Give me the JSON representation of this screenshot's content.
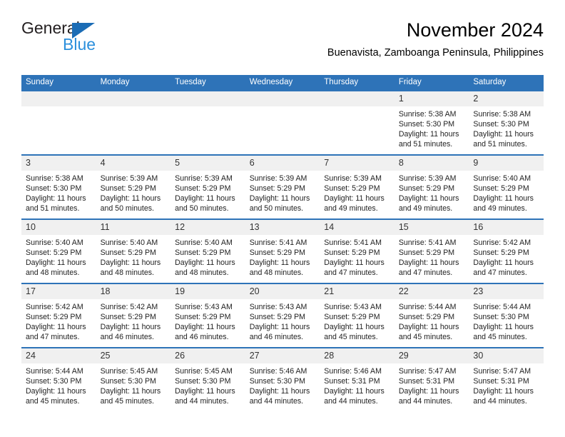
{
  "brand": {
    "name_top": "General",
    "name_bottom": "Blue",
    "triangle_color": "#1b6cb5",
    "bottom_color": "#2b8fdc"
  },
  "header": {
    "title": "November 2024",
    "subtitle": "Buenavista, Zamboanga Peninsula, Philippines"
  },
  "theme": {
    "header_blue": "#2e73b8",
    "daynum_band": "#f0f0f0",
    "cell_bg": "#ffffff",
    "text": "#222222"
  },
  "columns": [
    "Sunday",
    "Monday",
    "Tuesday",
    "Wednesday",
    "Thursday",
    "Friday",
    "Saturday"
  ],
  "weeks": [
    [
      {
        "day": "",
        "empty": true,
        "sunrise": "",
        "sunset": "",
        "daylight1": "",
        "daylight2": ""
      },
      {
        "day": "",
        "empty": true,
        "sunrise": "",
        "sunset": "",
        "daylight1": "",
        "daylight2": ""
      },
      {
        "day": "",
        "empty": true,
        "sunrise": "",
        "sunset": "",
        "daylight1": "",
        "daylight2": ""
      },
      {
        "day": "",
        "empty": true,
        "sunrise": "",
        "sunset": "",
        "daylight1": "",
        "daylight2": ""
      },
      {
        "day": "",
        "empty": true,
        "sunrise": "",
        "sunset": "",
        "daylight1": "",
        "daylight2": ""
      },
      {
        "day": "1",
        "empty": false,
        "sunrise": "Sunrise: 5:38 AM",
        "sunset": "Sunset: 5:30 PM",
        "daylight1": "Daylight: 11 hours",
        "daylight2": "and 51 minutes."
      },
      {
        "day": "2",
        "empty": false,
        "sunrise": "Sunrise: 5:38 AM",
        "sunset": "Sunset: 5:30 PM",
        "daylight1": "Daylight: 11 hours",
        "daylight2": "and 51 minutes."
      }
    ],
    [
      {
        "day": "3",
        "empty": false,
        "sunrise": "Sunrise: 5:38 AM",
        "sunset": "Sunset: 5:30 PM",
        "daylight1": "Daylight: 11 hours",
        "daylight2": "and 51 minutes."
      },
      {
        "day": "4",
        "empty": false,
        "sunrise": "Sunrise: 5:39 AM",
        "sunset": "Sunset: 5:29 PM",
        "daylight1": "Daylight: 11 hours",
        "daylight2": "and 50 minutes."
      },
      {
        "day": "5",
        "empty": false,
        "sunrise": "Sunrise: 5:39 AM",
        "sunset": "Sunset: 5:29 PM",
        "daylight1": "Daylight: 11 hours",
        "daylight2": "and 50 minutes."
      },
      {
        "day": "6",
        "empty": false,
        "sunrise": "Sunrise: 5:39 AM",
        "sunset": "Sunset: 5:29 PM",
        "daylight1": "Daylight: 11 hours",
        "daylight2": "and 50 minutes."
      },
      {
        "day": "7",
        "empty": false,
        "sunrise": "Sunrise: 5:39 AM",
        "sunset": "Sunset: 5:29 PM",
        "daylight1": "Daylight: 11 hours",
        "daylight2": "and 49 minutes."
      },
      {
        "day": "8",
        "empty": false,
        "sunrise": "Sunrise: 5:39 AM",
        "sunset": "Sunset: 5:29 PM",
        "daylight1": "Daylight: 11 hours",
        "daylight2": "and 49 minutes."
      },
      {
        "day": "9",
        "empty": false,
        "sunrise": "Sunrise: 5:40 AM",
        "sunset": "Sunset: 5:29 PM",
        "daylight1": "Daylight: 11 hours",
        "daylight2": "and 49 minutes."
      }
    ],
    [
      {
        "day": "10",
        "empty": false,
        "sunrise": "Sunrise: 5:40 AM",
        "sunset": "Sunset: 5:29 PM",
        "daylight1": "Daylight: 11 hours",
        "daylight2": "and 48 minutes."
      },
      {
        "day": "11",
        "empty": false,
        "sunrise": "Sunrise: 5:40 AM",
        "sunset": "Sunset: 5:29 PM",
        "daylight1": "Daylight: 11 hours",
        "daylight2": "and 48 minutes."
      },
      {
        "day": "12",
        "empty": false,
        "sunrise": "Sunrise: 5:40 AM",
        "sunset": "Sunset: 5:29 PM",
        "daylight1": "Daylight: 11 hours",
        "daylight2": "and 48 minutes."
      },
      {
        "day": "13",
        "empty": false,
        "sunrise": "Sunrise: 5:41 AM",
        "sunset": "Sunset: 5:29 PM",
        "daylight1": "Daylight: 11 hours",
        "daylight2": "and 48 minutes."
      },
      {
        "day": "14",
        "empty": false,
        "sunrise": "Sunrise: 5:41 AM",
        "sunset": "Sunset: 5:29 PM",
        "daylight1": "Daylight: 11 hours",
        "daylight2": "and 47 minutes."
      },
      {
        "day": "15",
        "empty": false,
        "sunrise": "Sunrise: 5:41 AM",
        "sunset": "Sunset: 5:29 PM",
        "daylight1": "Daylight: 11 hours",
        "daylight2": "and 47 minutes."
      },
      {
        "day": "16",
        "empty": false,
        "sunrise": "Sunrise: 5:42 AM",
        "sunset": "Sunset: 5:29 PM",
        "daylight1": "Daylight: 11 hours",
        "daylight2": "and 47 minutes."
      }
    ],
    [
      {
        "day": "17",
        "empty": false,
        "sunrise": "Sunrise: 5:42 AM",
        "sunset": "Sunset: 5:29 PM",
        "daylight1": "Daylight: 11 hours",
        "daylight2": "and 47 minutes."
      },
      {
        "day": "18",
        "empty": false,
        "sunrise": "Sunrise: 5:42 AM",
        "sunset": "Sunset: 5:29 PM",
        "daylight1": "Daylight: 11 hours",
        "daylight2": "and 46 minutes."
      },
      {
        "day": "19",
        "empty": false,
        "sunrise": "Sunrise: 5:43 AM",
        "sunset": "Sunset: 5:29 PM",
        "daylight1": "Daylight: 11 hours",
        "daylight2": "and 46 minutes."
      },
      {
        "day": "20",
        "empty": false,
        "sunrise": "Sunrise: 5:43 AM",
        "sunset": "Sunset: 5:29 PM",
        "daylight1": "Daylight: 11 hours",
        "daylight2": "and 46 minutes."
      },
      {
        "day": "21",
        "empty": false,
        "sunrise": "Sunrise: 5:43 AM",
        "sunset": "Sunset: 5:29 PM",
        "daylight1": "Daylight: 11 hours",
        "daylight2": "and 45 minutes."
      },
      {
        "day": "22",
        "empty": false,
        "sunrise": "Sunrise: 5:44 AM",
        "sunset": "Sunset: 5:29 PM",
        "daylight1": "Daylight: 11 hours",
        "daylight2": "and 45 minutes."
      },
      {
        "day": "23",
        "empty": false,
        "sunrise": "Sunrise: 5:44 AM",
        "sunset": "Sunset: 5:30 PM",
        "daylight1": "Daylight: 11 hours",
        "daylight2": "and 45 minutes."
      }
    ],
    [
      {
        "day": "24",
        "empty": false,
        "sunrise": "Sunrise: 5:44 AM",
        "sunset": "Sunset: 5:30 PM",
        "daylight1": "Daylight: 11 hours",
        "daylight2": "and 45 minutes."
      },
      {
        "day": "25",
        "empty": false,
        "sunrise": "Sunrise: 5:45 AM",
        "sunset": "Sunset: 5:30 PM",
        "daylight1": "Daylight: 11 hours",
        "daylight2": "and 45 minutes."
      },
      {
        "day": "26",
        "empty": false,
        "sunrise": "Sunrise: 5:45 AM",
        "sunset": "Sunset: 5:30 PM",
        "daylight1": "Daylight: 11 hours",
        "daylight2": "and 44 minutes."
      },
      {
        "day": "27",
        "empty": false,
        "sunrise": "Sunrise: 5:46 AM",
        "sunset": "Sunset: 5:30 PM",
        "daylight1": "Daylight: 11 hours",
        "daylight2": "and 44 minutes."
      },
      {
        "day": "28",
        "empty": false,
        "sunrise": "Sunrise: 5:46 AM",
        "sunset": "Sunset: 5:31 PM",
        "daylight1": "Daylight: 11 hours",
        "daylight2": "and 44 minutes."
      },
      {
        "day": "29",
        "empty": false,
        "sunrise": "Sunrise: 5:47 AM",
        "sunset": "Sunset: 5:31 PM",
        "daylight1": "Daylight: 11 hours",
        "daylight2": "and 44 minutes."
      },
      {
        "day": "30",
        "empty": false,
        "sunrise": "Sunrise: 5:47 AM",
        "sunset": "Sunset: 5:31 PM",
        "daylight1": "Daylight: 11 hours",
        "daylight2": "and 44 minutes."
      }
    ]
  ]
}
